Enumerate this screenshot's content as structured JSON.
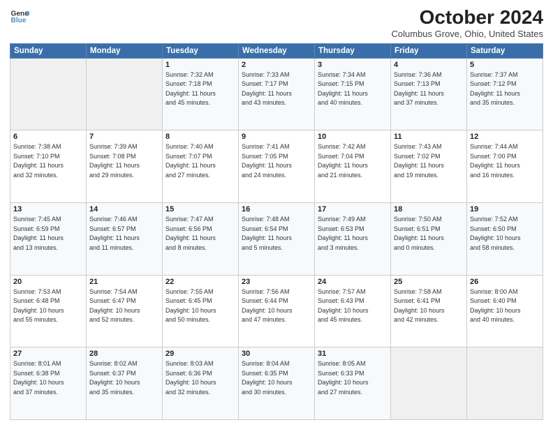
{
  "logo": {
    "line1": "General",
    "line2": "Blue"
  },
  "title": "October 2024",
  "subtitle": "Columbus Grove, Ohio, United States",
  "days_of_week": [
    "Sunday",
    "Monday",
    "Tuesday",
    "Wednesday",
    "Thursday",
    "Friday",
    "Saturday"
  ],
  "weeks": [
    [
      {
        "day": "",
        "info": ""
      },
      {
        "day": "",
        "info": ""
      },
      {
        "day": "1",
        "info": "Sunrise: 7:32 AM\nSunset: 7:18 PM\nDaylight: 11 hours\nand 45 minutes."
      },
      {
        "day": "2",
        "info": "Sunrise: 7:33 AM\nSunset: 7:17 PM\nDaylight: 11 hours\nand 43 minutes."
      },
      {
        "day": "3",
        "info": "Sunrise: 7:34 AM\nSunset: 7:15 PM\nDaylight: 11 hours\nand 40 minutes."
      },
      {
        "day": "4",
        "info": "Sunrise: 7:36 AM\nSunset: 7:13 PM\nDaylight: 11 hours\nand 37 minutes."
      },
      {
        "day": "5",
        "info": "Sunrise: 7:37 AM\nSunset: 7:12 PM\nDaylight: 11 hours\nand 35 minutes."
      }
    ],
    [
      {
        "day": "6",
        "info": "Sunrise: 7:38 AM\nSunset: 7:10 PM\nDaylight: 11 hours\nand 32 minutes."
      },
      {
        "day": "7",
        "info": "Sunrise: 7:39 AM\nSunset: 7:08 PM\nDaylight: 11 hours\nand 29 minutes."
      },
      {
        "day": "8",
        "info": "Sunrise: 7:40 AM\nSunset: 7:07 PM\nDaylight: 11 hours\nand 27 minutes."
      },
      {
        "day": "9",
        "info": "Sunrise: 7:41 AM\nSunset: 7:05 PM\nDaylight: 11 hours\nand 24 minutes."
      },
      {
        "day": "10",
        "info": "Sunrise: 7:42 AM\nSunset: 7:04 PM\nDaylight: 11 hours\nand 21 minutes."
      },
      {
        "day": "11",
        "info": "Sunrise: 7:43 AM\nSunset: 7:02 PM\nDaylight: 11 hours\nand 19 minutes."
      },
      {
        "day": "12",
        "info": "Sunrise: 7:44 AM\nSunset: 7:00 PM\nDaylight: 11 hours\nand 16 minutes."
      }
    ],
    [
      {
        "day": "13",
        "info": "Sunrise: 7:45 AM\nSunset: 6:59 PM\nDaylight: 11 hours\nand 13 minutes."
      },
      {
        "day": "14",
        "info": "Sunrise: 7:46 AM\nSunset: 6:57 PM\nDaylight: 11 hours\nand 11 minutes."
      },
      {
        "day": "15",
        "info": "Sunrise: 7:47 AM\nSunset: 6:56 PM\nDaylight: 11 hours\nand 8 minutes."
      },
      {
        "day": "16",
        "info": "Sunrise: 7:48 AM\nSunset: 6:54 PM\nDaylight: 11 hours\nand 5 minutes."
      },
      {
        "day": "17",
        "info": "Sunrise: 7:49 AM\nSunset: 6:53 PM\nDaylight: 11 hours\nand 3 minutes."
      },
      {
        "day": "18",
        "info": "Sunrise: 7:50 AM\nSunset: 6:51 PM\nDaylight: 11 hours\nand 0 minutes."
      },
      {
        "day": "19",
        "info": "Sunrise: 7:52 AM\nSunset: 6:50 PM\nDaylight: 10 hours\nand 58 minutes."
      }
    ],
    [
      {
        "day": "20",
        "info": "Sunrise: 7:53 AM\nSunset: 6:48 PM\nDaylight: 10 hours\nand 55 minutes."
      },
      {
        "day": "21",
        "info": "Sunrise: 7:54 AM\nSunset: 6:47 PM\nDaylight: 10 hours\nand 52 minutes."
      },
      {
        "day": "22",
        "info": "Sunrise: 7:55 AM\nSunset: 6:45 PM\nDaylight: 10 hours\nand 50 minutes."
      },
      {
        "day": "23",
        "info": "Sunrise: 7:56 AM\nSunset: 6:44 PM\nDaylight: 10 hours\nand 47 minutes."
      },
      {
        "day": "24",
        "info": "Sunrise: 7:57 AM\nSunset: 6:43 PM\nDaylight: 10 hours\nand 45 minutes."
      },
      {
        "day": "25",
        "info": "Sunrise: 7:58 AM\nSunset: 6:41 PM\nDaylight: 10 hours\nand 42 minutes."
      },
      {
        "day": "26",
        "info": "Sunrise: 8:00 AM\nSunset: 6:40 PM\nDaylight: 10 hours\nand 40 minutes."
      }
    ],
    [
      {
        "day": "27",
        "info": "Sunrise: 8:01 AM\nSunset: 6:38 PM\nDaylight: 10 hours\nand 37 minutes."
      },
      {
        "day": "28",
        "info": "Sunrise: 8:02 AM\nSunset: 6:37 PM\nDaylight: 10 hours\nand 35 minutes."
      },
      {
        "day": "29",
        "info": "Sunrise: 8:03 AM\nSunset: 6:36 PM\nDaylight: 10 hours\nand 32 minutes."
      },
      {
        "day": "30",
        "info": "Sunrise: 8:04 AM\nSunset: 6:35 PM\nDaylight: 10 hours\nand 30 minutes."
      },
      {
        "day": "31",
        "info": "Sunrise: 8:05 AM\nSunset: 6:33 PM\nDaylight: 10 hours\nand 27 minutes."
      },
      {
        "day": "",
        "info": ""
      },
      {
        "day": "",
        "info": ""
      }
    ]
  ]
}
